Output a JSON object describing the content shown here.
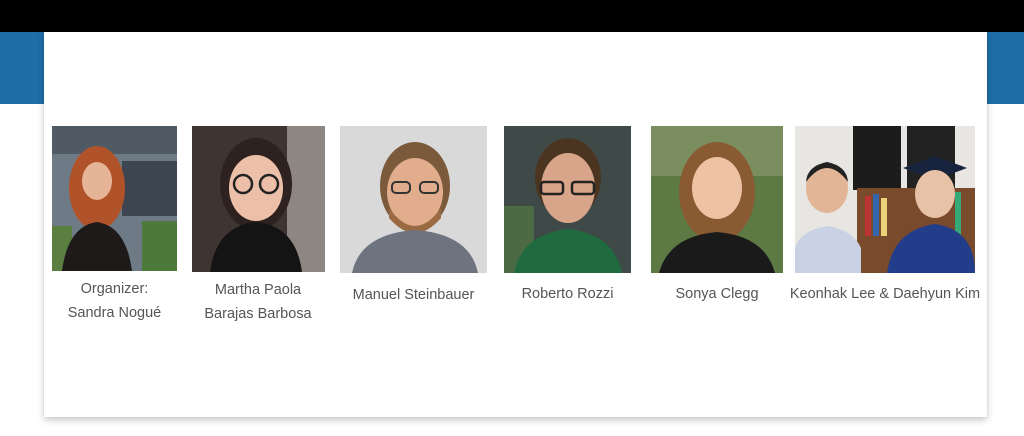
{
  "people": [
    {
      "caption": [
        "Organizer:",
        "Sandra Nogué"
      ],
      "photo_icon": "portrait-photo"
    },
    {
      "caption": [
        "Martha Paola",
        "Barajas Barbosa"
      ],
      "photo_icon": "portrait-photo"
    },
    {
      "caption": [
        "Manuel Steinbauer"
      ],
      "photo_icon": "portrait-photo"
    },
    {
      "caption": [
        "Roberto Rozzi"
      ],
      "photo_icon": "portrait-photo"
    },
    {
      "caption": [
        "Sonya Clegg"
      ],
      "photo_icon": "portrait-photo"
    },
    {
      "caption": [
        "Keonhak Lee & Daehyun Kim"
      ],
      "photo_icon": "portrait-photo"
    }
  ],
  "colors": {
    "top_bar": "#000000",
    "side_band": "#1f6ea8",
    "caption_text": "#555555"
  }
}
